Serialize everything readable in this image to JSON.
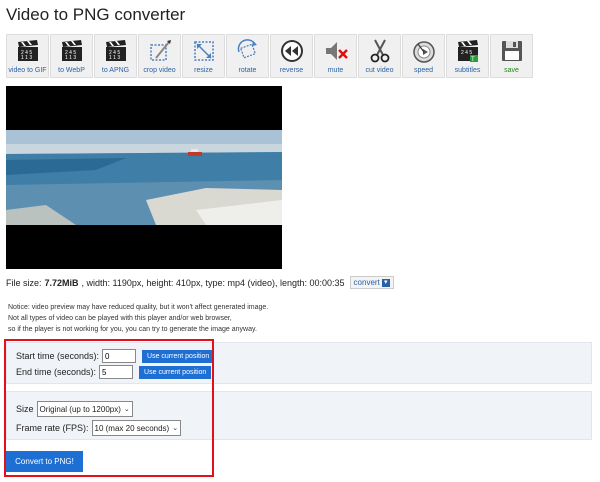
{
  "title": "Video to PNG converter",
  "toolbar": [
    {
      "name": "video-to-gif",
      "label": "video to GIF",
      "icon": "clapperboard-icon"
    },
    {
      "name": "to-webp",
      "label": "to WebP",
      "icon": "clapperboard-icon"
    },
    {
      "name": "to-apng",
      "label": "to APNG",
      "icon": "clapperboard-icon"
    },
    {
      "name": "crop-video",
      "label": "crop video",
      "icon": "crop-icon"
    },
    {
      "name": "resize",
      "label": "resize",
      "icon": "resize-icon"
    },
    {
      "name": "rotate",
      "label": "rotate",
      "icon": "rotate-icon"
    },
    {
      "name": "reverse",
      "label": "reverse",
      "icon": "rewind-icon"
    },
    {
      "name": "mute",
      "label": "mute",
      "icon": "mute-icon"
    },
    {
      "name": "cut-video",
      "label": "cut video",
      "icon": "scissors-icon"
    },
    {
      "name": "speed",
      "label": "speed",
      "icon": "speedometer-icon"
    },
    {
      "name": "subtitles",
      "label": "subtitles",
      "icon": "clapperboard-icon"
    },
    {
      "name": "save",
      "label": "save",
      "icon": "floppy-disk-icon"
    }
  ],
  "fileinfo": {
    "prefix": "File size: ",
    "size": "7.72MiB",
    "details": ", width: 1190px, height: 410px, type: mp4 (video), length: 00:00:35",
    "convert_label": "convert"
  },
  "notice": {
    "line1": "Notice: video preview may have reduced quality, but it won't affect generated image.",
    "line2": "Not all types of video can be played with this player and/or web browser,",
    "line3": "so if the player is not working for you, you can try to generate the image anyway."
  },
  "form": {
    "start_label": "Start time (seconds):",
    "start_value": "0",
    "end_label": "End time (seconds):",
    "end_value": "5",
    "use_current_label": "Use current position",
    "size_label": "Size",
    "size_value": "Original (up to 1200px)",
    "fps_label": "Frame rate (FPS):",
    "fps_value": "10 (max 20 seconds)",
    "submit_label": "Convert to PNG!"
  },
  "colors": {
    "accent": "#1e6fd4",
    "highlight": "#e0111a",
    "link": "#2a62a8"
  }
}
